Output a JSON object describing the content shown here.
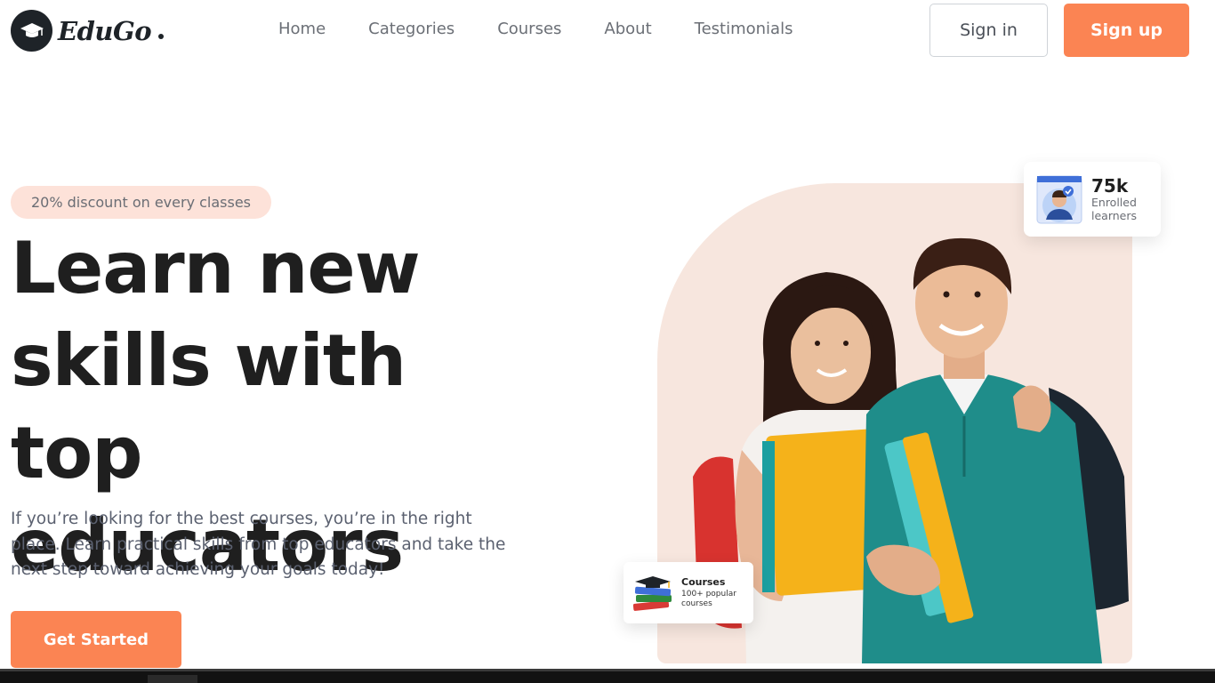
{
  "brand": {
    "name": "EduGo"
  },
  "nav": {
    "items": [
      "Home",
      "Categories",
      "Courses",
      "About",
      "Testimonials"
    ]
  },
  "auth": {
    "signin_label": "Sign in",
    "signup_label": "Sign up"
  },
  "hero": {
    "promo": "20% discount on every classes",
    "headline_lines": [
      "Learn new",
      "skills with top",
      "educators"
    ],
    "subtext": "If you’re looking for the best courses, you’re in the right place. Learn practical skills from top educators and take the next step toward achieving your goals today!",
    "cta_label": "Get Started"
  },
  "stats": {
    "learners": {
      "value": "75k",
      "label": "Enrolled learners"
    },
    "courses": {
      "title": "Courses",
      "subtitle": "100+ popular courses"
    }
  },
  "colors": {
    "accent": "#fb8453",
    "promo_bg": "#fde2d9",
    "hero_bg": "#f7e6de",
    "dark": "#1e2328"
  },
  "icons": {
    "logo": "graduation-cap-icon",
    "learner_avatar": "learner-avatar-icon",
    "books": "books-icon"
  }
}
